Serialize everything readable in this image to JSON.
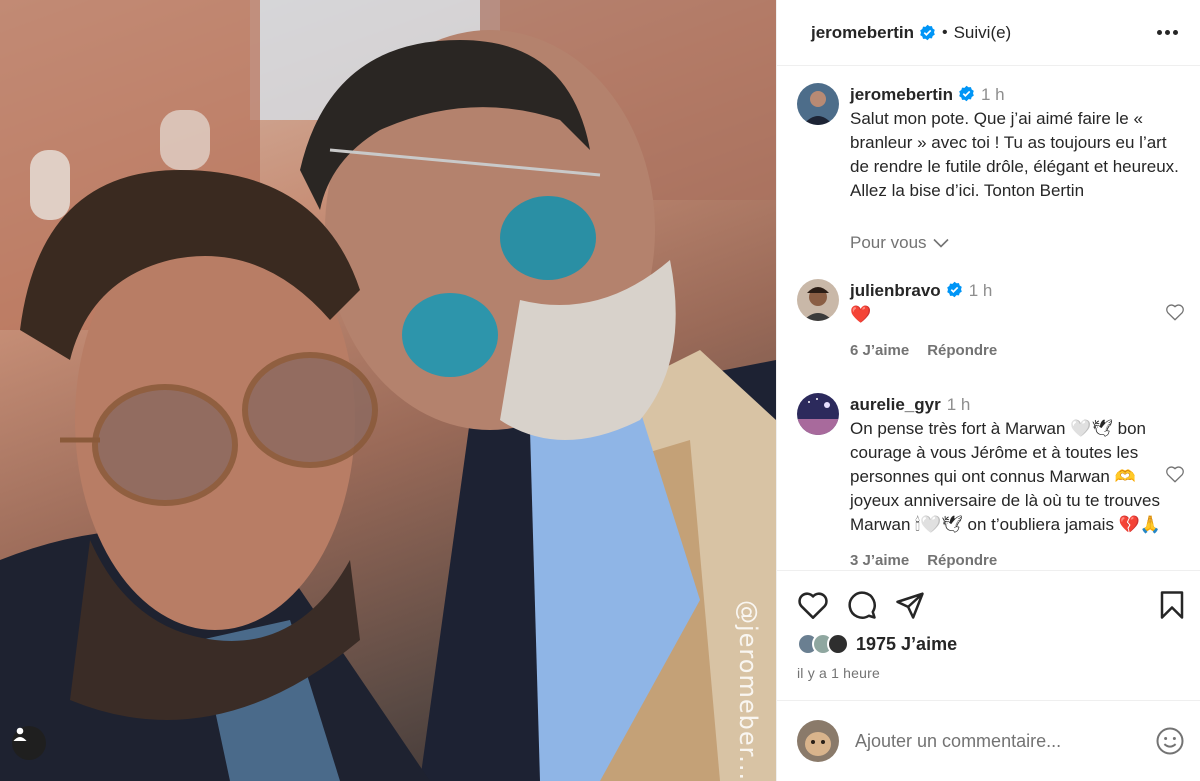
{
  "post": {
    "author": "jeromebertin",
    "follow_status": "Suivi(e)",
    "watermark": "@jeromeber..."
  },
  "caption": {
    "username": "jeromebertin",
    "time": "1 h",
    "text": "Salut mon pote. Que j’ai aimé faire le « branleur » avec toi ! Tu as toujours eu l’art de rendre le futile drôle, élégant et heureux. Allez la bise d’ici. Tonton Bertin",
    "for_you_label": "Pour vous"
  },
  "comments": [
    {
      "username": "julienbravo",
      "verified": true,
      "time": "1 h",
      "text": "❤️",
      "likes_label": "6 J’aime",
      "reply_label": "Répondre"
    },
    {
      "username": "aurelie_gyr",
      "verified": false,
      "time": "1 h",
      "text": "On pense très fort à Marwan 🤍🕊 bon courage à vous Jérôme et à toutes les personnes qui ont connus Marwan 🫶 joyeux anniversaire de là où tu te trouves Marwan 🕯🤍🕊 on t’oubliera jamais 💔🙏",
      "likes_label": "3 J’aime",
      "reply_label": "Répondre"
    }
  ],
  "engagement": {
    "likes_count": "1975 J’aime",
    "posted_ago": "il y a 1 heure"
  },
  "composer": {
    "placeholder": "Ajouter un commentaire..."
  },
  "colors": {
    "verified_blue": "#0095f6",
    "text": "#262626",
    "secondary_text": "#737373",
    "divider": "#efefef",
    "heart_red": "#ed4956"
  },
  "icons": {
    "more": "more-horizontal-icon",
    "like": "heart-icon",
    "comment": "comment-icon",
    "share": "paper-plane-icon",
    "save": "bookmark-icon",
    "emoji": "smiley-icon",
    "user_tag": "user-icon",
    "verified": "verified-badge-icon"
  }
}
